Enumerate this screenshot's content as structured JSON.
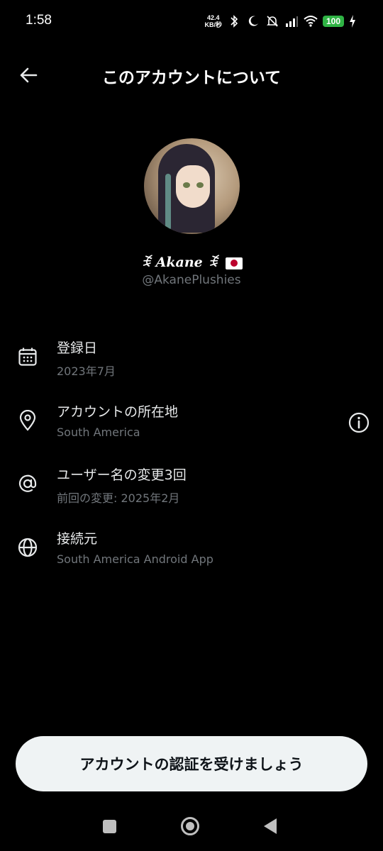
{
  "status_bar": {
    "time": "1:58",
    "net_speed_value": "42.4",
    "net_speed_unit": "KB/秒",
    "battery": "100",
    "icons": [
      "bluetooth-icon",
      "moon-icon",
      "mute-icon",
      "signal-icon",
      "wifi-icon",
      "battery-icon",
      "charging-icon"
    ]
  },
  "header": {
    "title": "このアカウントについて",
    "back_icon": "arrow-left-icon"
  },
  "profile": {
    "display_name": "ꉂ Akane ꉂ",
    "flag": "japan-flag-icon",
    "username": "@AkanePlushies"
  },
  "info": {
    "joined": {
      "title": "登録日",
      "value": "2023年7月",
      "icon": "calendar-icon"
    },
    "location": {
      "title": "アカウントの所在地",
      "value": "South America",
      "icon": "location-pin-icon",
      "action_icon": "info-circle-icon"
    },
    "username_changes": {
      "title": "ユーザー名の変更3回",
      "value": "前回の変更: 2025年2月",
      "icon": "at-sign-icon"
    },
    "connected_via": {
      "title": "接続元",
      "value": "South America Android App",
      "icon": "globe-icon"
    }
  },
  "cta": {
    "label": "アカウントの認証を受けましょう"
  },
  "colors": {
    "background": "#000000",
    "text_primary": "#e7e9ea",
    "text_secondary": "#71767b",
    "cta_bg": "#eff3f4",
    "cta_text": "#0f1419",
    "battery": "#2fb344"
  }
}
